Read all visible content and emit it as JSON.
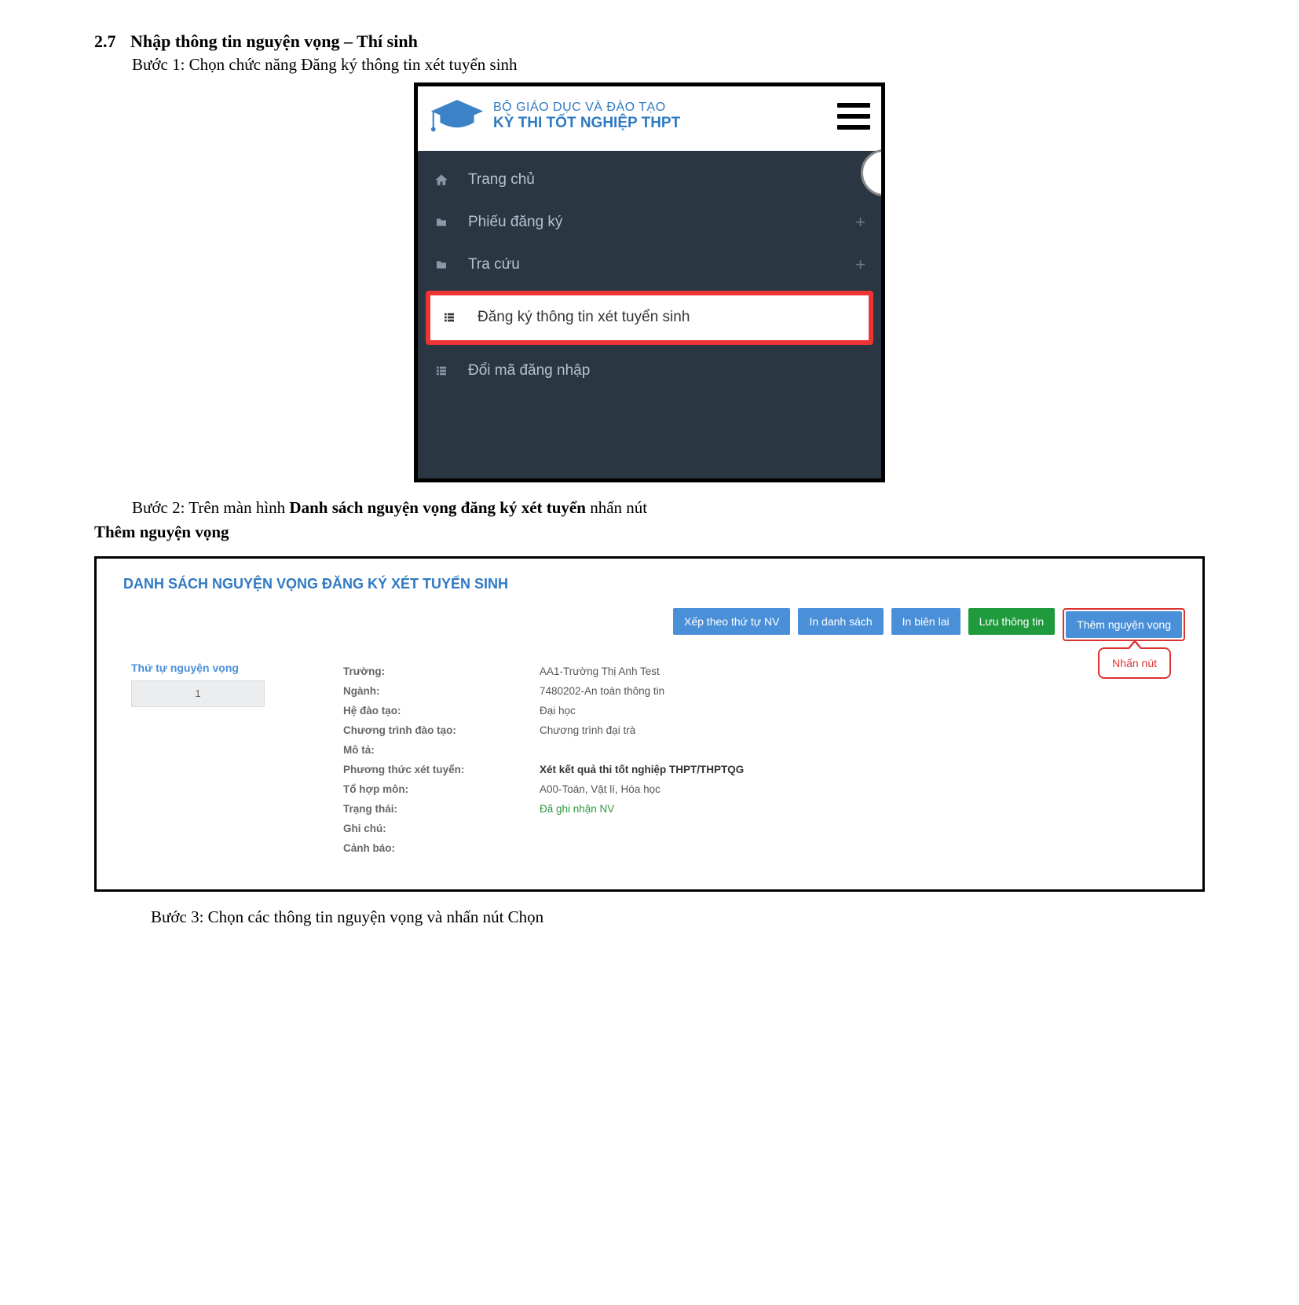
{
  "doc": {
    "section_number": "2.7",
    "section_title": "Nhập thông tin nguyện vọng – Thí sinh",
    "step1": "Bước 1: Chọn chức năng Đăng ký thông tin xét tuyển sinh",
    "step2_prefix": "Bước 2: Trên màn hình ",
    "step2_bold1": "Danh sách nguyện vọng đăng ký xét tuyển",
    "step2_mid": " nhấn nút",
    "step2_bold2": "Thêm nguyện vọng",
    "step3": "Bước 3: Chọn các thông tin nguyện vọng và nhấn nút Chọn"
  },
  "shot1": {
    "brand_line1": "BỘ GIÁO DỤC VÀ ĐÀO TẠO",
    "brand_line2": "KỲ THI TỐT NGHIỆP THPT",
    "items": {
      "home": "Trang chủ",
      "form": "Phiếu đăng ký",
      "lookup": "Tra cứu",
      "register": "Đăng ký thông tin xét tuyển sinh",
      "changepw": "Đổi mã đăng nhập"
    }
  },
  "shot2": {
    "title": "DANH SÁCH NGUYỆN VỌNG ĐĂNG KÝ XÉT TUYỂN SINH",
    "buttons": {
      "sort": "Xếp theo thứ tự NV",
      "print_list": "In danh sách",
      "print_receipt": "In biên lai",
      "save": "Lưu thông tin",
      "add": "Thêm nguyện vọng"
    },
    "callout": "Nhấn nút",
    "order_label": "Thứ tự nguyện vọng",
    "order_value": "1",
    "labels": {
      "school": "Trường:",
      "major": "Ngành:",
      "system": "Hệ đào tạo:",
      "program": "Chương trình đào tạo:",
      "desc": "Mô tả:",
      "method": "Phương thức xét tuyển:",
      "combo": "Tổ hợp môn:",
      "status": "Trạng thái:",
      "note": "Ghi chú:",
      "warn": "Cảnh báo:"
    },
    "values": {
      "school": "AA1-Trường Thị Anh Test",
      "major": "7480202-An toàn thông tin",
      "system": "Đại học",
      "program": "Chương trình đại trà",
      "desc": "",
      "method": "Xét kết quả thi tốt nghiệp THPT/THPTQG",
      "combo": "A00-Toán, Vật lí, Hóa học",
      "status": "Đã ghi nhận NV",
      "note": "",
      "warn": ""
    }
  }
}
